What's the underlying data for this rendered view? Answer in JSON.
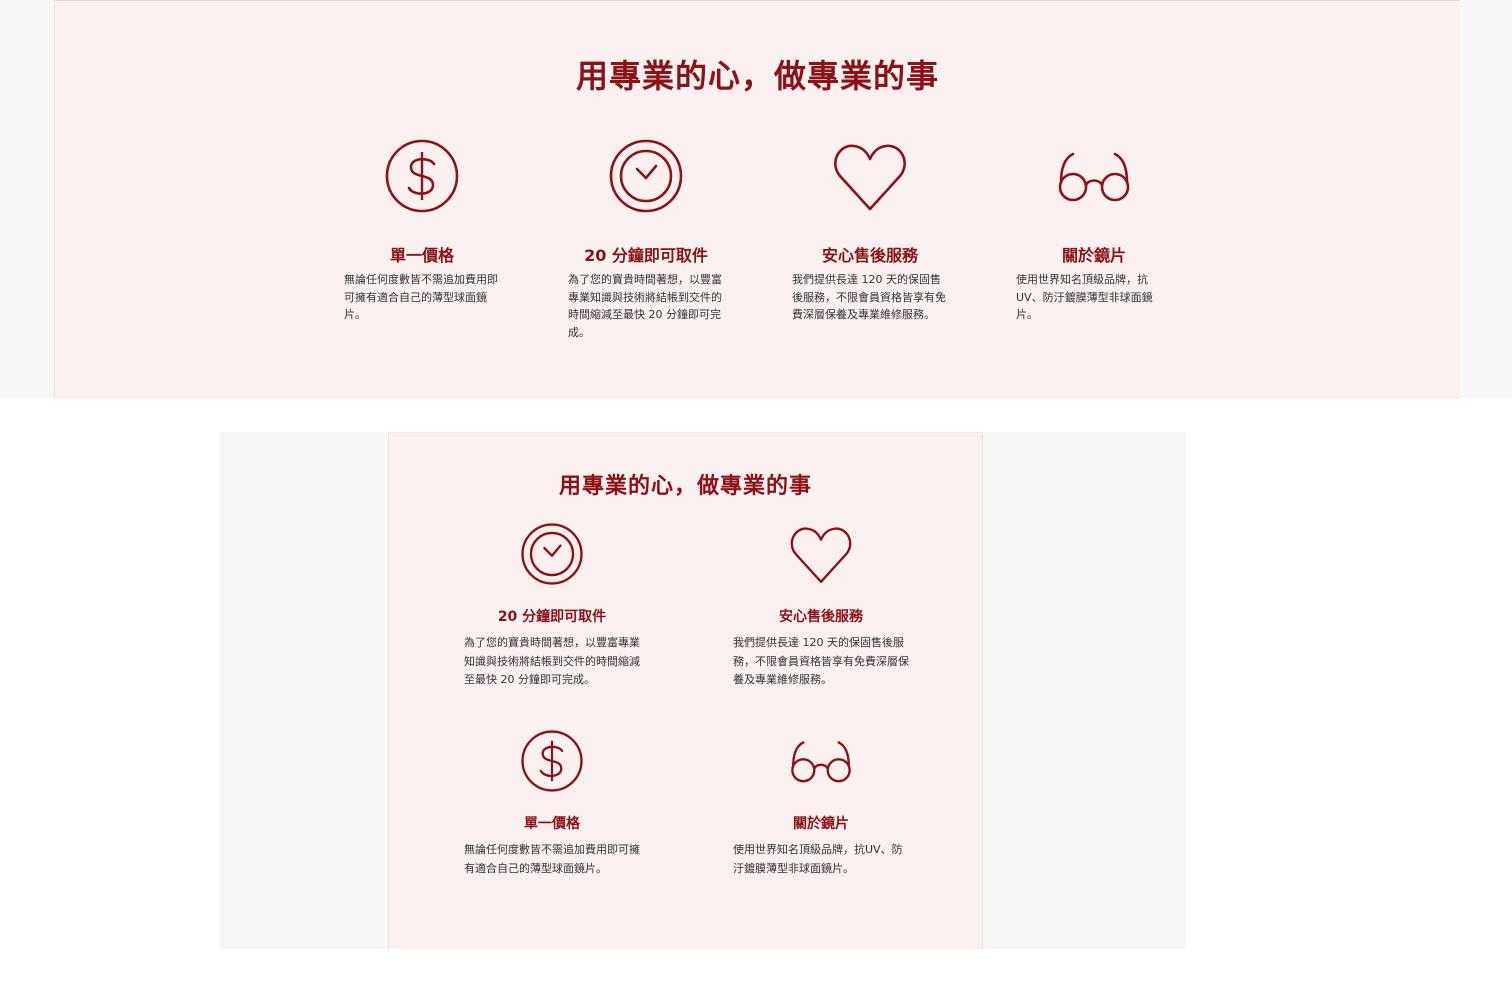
{
  "accent_color": "#8b1217",
  "background_color": "#f9f0ef",
  "heading": "用專業的心，做專業的事",
  "features": {
    "price": {
      "icon": "dollar-icon",
      "title": "單一價格",
      "desc_desktop": "無論任何度數皆不需追加費用即可擁有適合自己的薄型球面鏡片。",
      "desc_mobile": "無論任何度數皆不需追加費用即可擁有適合自己的薄型球面鏡片。"
    },
    "speed": {
      "icon": "clock-icon",
      "title": "20 分鐘即可取件",
      "desc_desktop": "為了您的寶貴時間著想，以豐富專業知識與技術將結帳到交件的時間縮減至最快 20 分鐘即可完成。",
      "desc_mobile": "為了您的寶貴時間著想，以豐富專業知識與技術將結帳到交件的時間縮減至最快 20 分鐘即可完成。"
    },
    "service": {
      "icon": "heart-icon",
      "title": "安心售後服務",
      "desc_desktop": "我們提供長達 120 天的保固售後服務，不限會員資格皆享有免費深層保養及專業維修服務。",
      "desc_mobile": "我們提供長達 120 天的保固售後服務，不限會員資格皆享有免費深層保養及專業維修服務。"
    },
    "lens": {
      "icon": "glasses-icon",
      "title": "關於鏡片",
      "desc_desktop": "使用世界知名頂級品牌，抗UV、防汙鍍膜薄型非球面鏡片。",
      "desc_mobile": "使用世界知名頂級品牌，抗UV、防汙鍍膜薄型非球面鏡片。"
    }
  }
}
